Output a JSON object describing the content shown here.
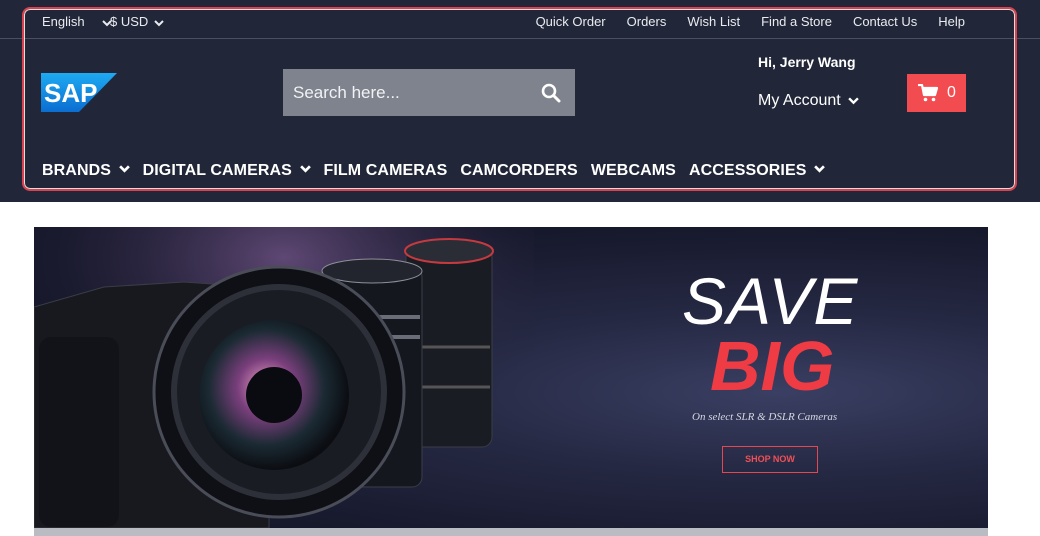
{
  "topbar": {
    "language": "English",
    "currency": "$ USD",
    "links": [
      "Quick Order",
      "Orders",
      "Wish List",
      "Find a Store",
      "Contact Us",
      "Help"
    ]
  },
  "brand": {
    "logo_text": "SAP"
  },
  "search": {
    "placeholder": "Search here..."
  },
  "user": {
    "greeting": "Hi, Jerry Wang",
    "account_label": "My Account"
  },
  "cart": {
    "count": "0"
  },
  "nav": {
    "items": [
      {
        "label": "BRANDS",
        "dropdown": true
      },
      {
        "label": "DIGITAL CAMERAS",
        "dropdown": true
      },
      {
        "label": "FILM CAMERAS",
        "dropdown": false
      },
      {
        "label": "CAMCORDERS",
        "dropdown": false
      },
      {
        "label": "WEBCAMS",
        "dropdown": false
      },
      {
        "label": "ACCESSORIES",
        "dropdown": true
      }
    ]
  },
  "banner": {
    "headline_1": "SAVE",
    "headline_2": "BIG",
    "tagline": "On select SLR & DSLR Cameras",
    "cta": "SHOP NOW"
  },
  "colors": {
    "header_bg": "#212738",
    "accent_red": "#f24b50",
    "search_bg": "#7e838d",
    "highlight_border": "#d9424f"
  }
}
